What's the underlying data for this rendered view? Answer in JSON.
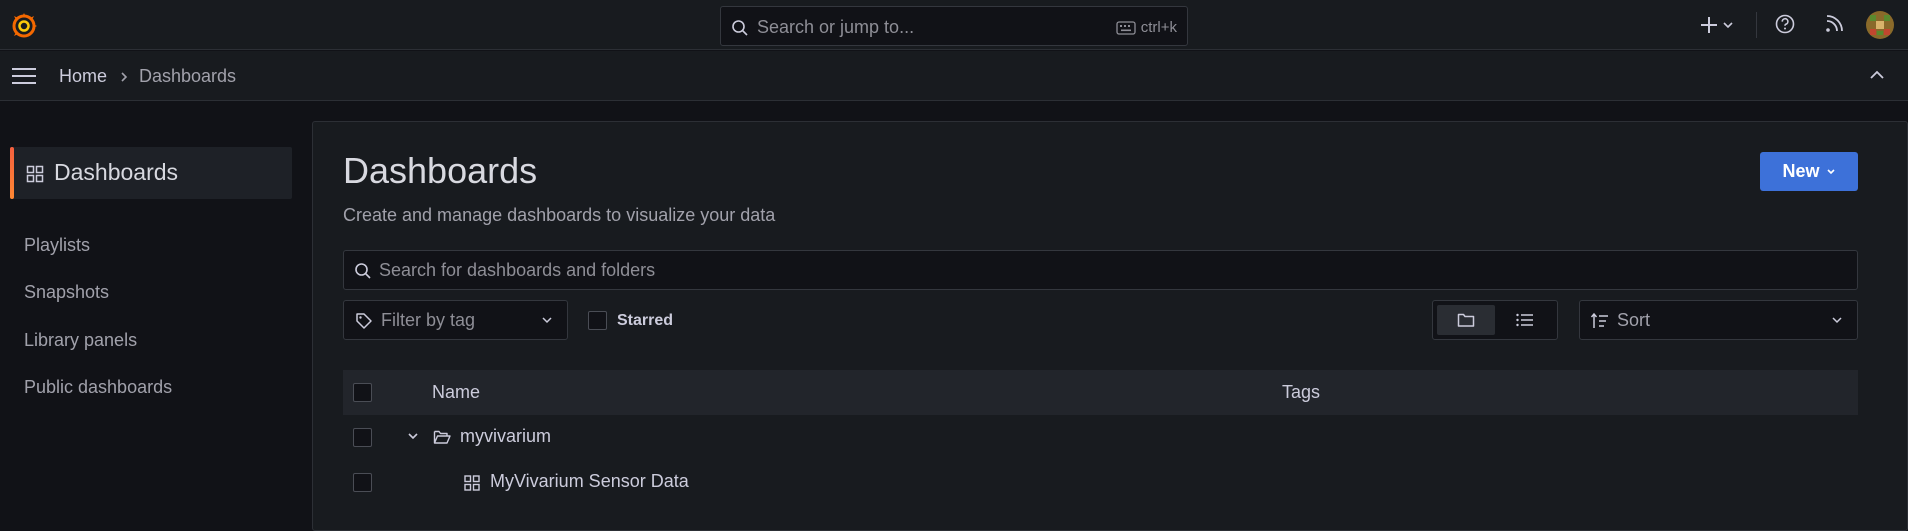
{
  "topbar": {
    "logo": "grafana-logo-icon",
    "search_placeholder": "Search or jump to...",
    "shortcut": "ctrl+k",
    "icons": [
      "plus-icon",
      "chevron-down-icon",
      "help-icon",
      "rss-icon"
    ],
    "accent_color": "#f46800"
  },
  "breadcrumb": {
    "home": "Home",
    "current": "Dashboards"
  },
  "sidebar": {
    "active": "Dashboards",
    "items": [
      {
        "label": "Playlists"
      },
      {
        "label": "Snapshots"
      },
      {
        "label": "Library panels"
      },
      {
        "label": "Public dashboards"
      }
    ]
  },
  "main": {
    "title": "Dashboards",
    "subtitle": "Create and manage dashboards to visualize your data",
    "new_button": "New",
    "search_placeholder": "Search for dashboards and folders",
    "tag_filter": "Filter by tag",
    "starred_label": "Starred",
    "sort_label": "Sort",
    "table": {
      "columns": [
        "Name",
        "Tags"
      ],
      "rows": [
        {
          "type": "folder",
          "name": "myvivarium",
          "expanded": true
        },
        {
          "type": "dashboard",
          "name": "MyVivarium Sensor Data"
        }
      ]
    },
    "primary_color": "#3d71d9"
  }
}
